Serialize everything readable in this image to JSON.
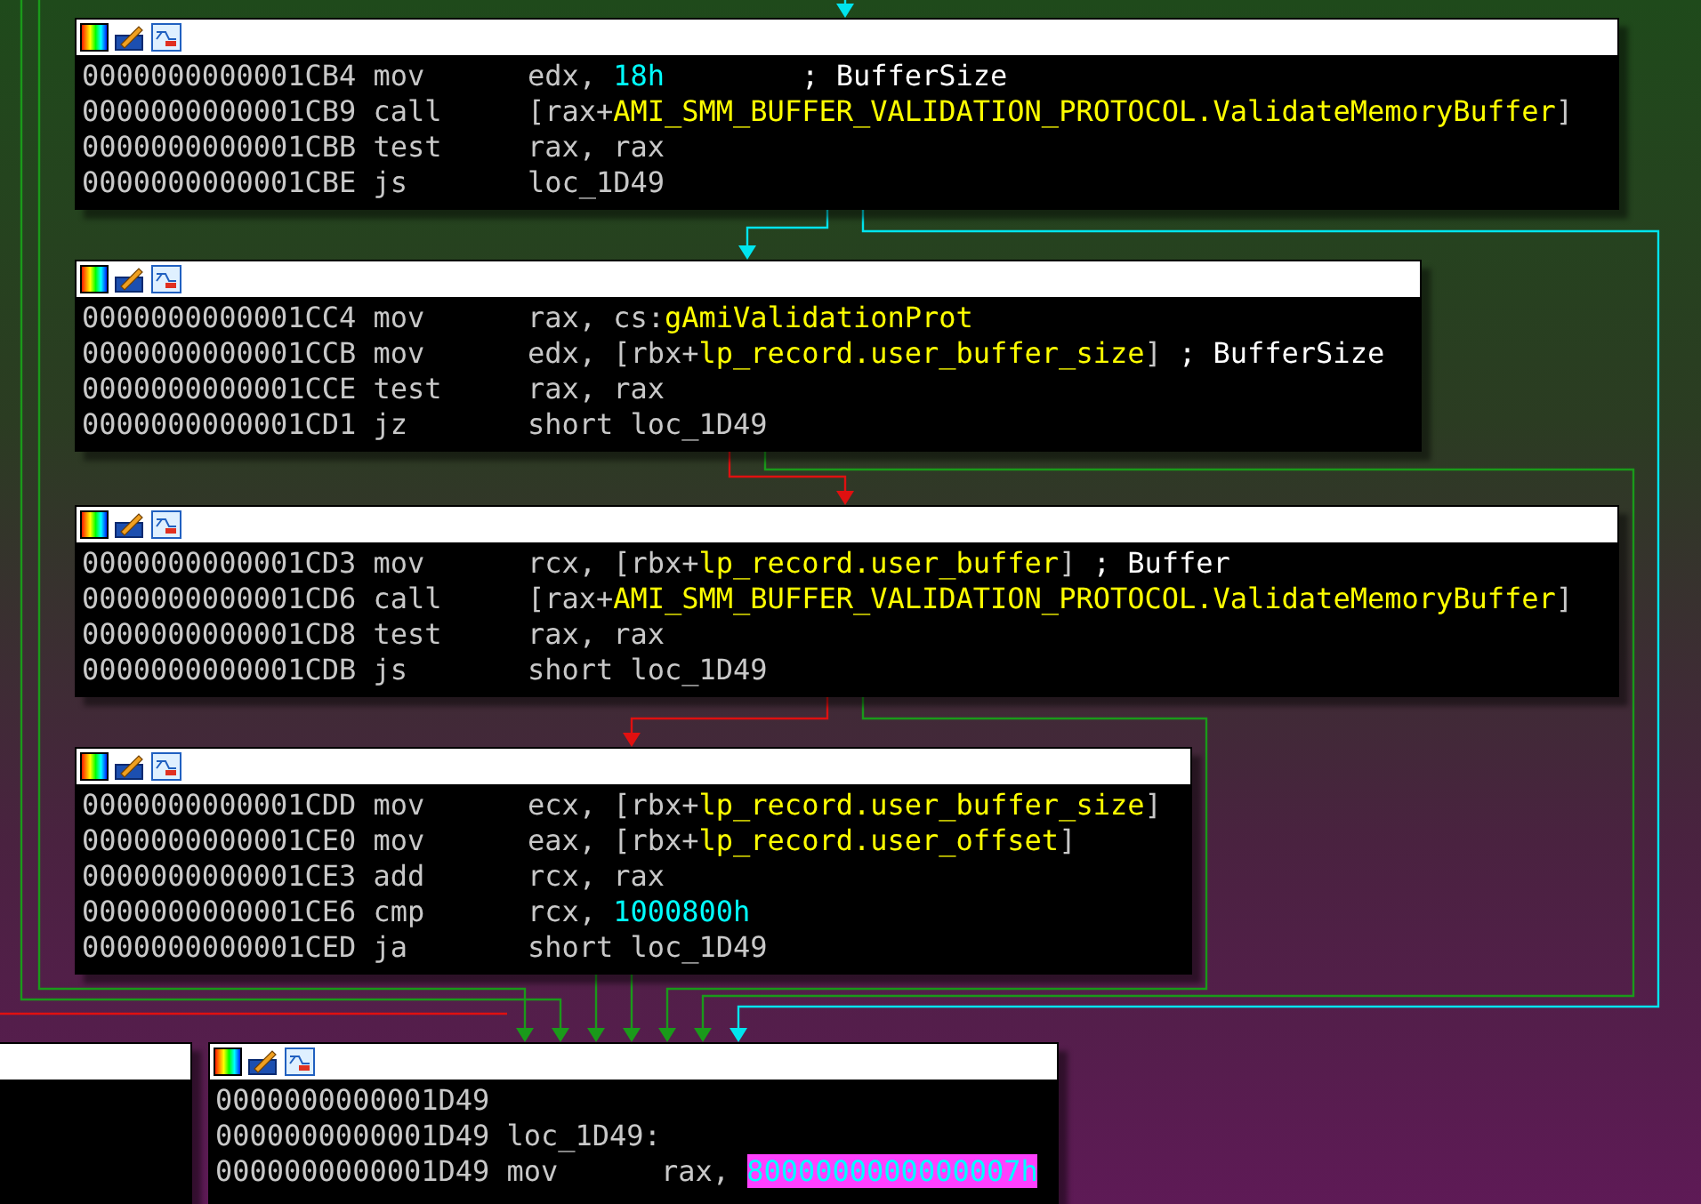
{
  "nodes": [
    {
      "kind": "block",
      "lines": [
        {
          "address": "0000000000001CB4",
          "mnemonic": "mov",
          "operands": [
            {
              "text": "edx, ",
              "kind": "plain"
            },
            {
              "text": "18h",
              "kind": "number"
            }
          ],
          "comment": "; BufferSize"
        },
        {
          "address": "0000000000001CB9",
          "mnemonic": "call",
          "operands": [
            {
              "text": "[rax+",
              "kind": "plain"
            },
            {
              "text": "AMI_SMM_BUFFER_VALIDATION_PROTOCOL.ValidateMemoryBuffer",
              "kind": "name"
            },
            {
              "text": "]",
              "kind": "plain"
            }
          ]
        },
        {
          "address": "0000000000001CBB",
          "mnemonic": "test",
          "operands": [
            {
              "text": "rax, rax",
              "kind": "plain"
            }
          ]
        },
        {
          "address": "0000000000001CBE",
          "mnemonic": "js",
          "operands": [
            {
              "text": "loc_1D49",
              "kind": "plain"
            }
          ]
        }
      ]
    },
    {
      "kind": "block",
      "lines": [
        {
          "address": "0000000000001CC4",
          "mnemonic": "mov",
          "operands": [
            {
              "text": "rax, cs:",
              "kind": "plain"
            },
            {
              "text": "gAmiValidationProt",
              "kind": "name"
            }
          ]
        },
        {
          "address": "0000000000001CCB",
          "mnemonic": "mov",
          "operands": [
            {
              "text": "edx, [rbx+",
              "kind": "plain"
            },
            {
              "text": "lp_record.user_buffer_size",
              "kind": "name"
            },
            {
              "text": "]",
              "kind": "plain"
            }
          ],
          "comment": "; BufferSize"
        },
        {
          "address": "0000000000001CCE",
          "mnemonic": "test",
          "operands": [
            {
              "text": "rax, rax",
              "kind": "plain"
            }
          ]
        },
        {
          "address": "0000000000001CD1",
          "mnemonic": "jz",
          "operands": [
            {
              "text": "short loc_1D49",
              "kind": "plain"
            }
          ]
        }
      ]
    },
    {
      "kind": "block",
      "lines": [
        {
          "address": "0000000000001CD3",
          "mnemonic": "mov",
          "operands": [
            {
              "text": "rcx, [rbx+",
              "kind": "plain"
            },
            {
              "text": "lp_record.user_buffer",
              "kind": "name"
            },
            {
              "text": "]",
              "kind": "plain"
            }
          ],
          "comment": "; Buffer"
        },
        {
          "address": "0000000000001CD6",
          "mnemonic": "call",
          "operands": [
            {
              "text": "[rax+",
              "kind": "plain"
            },
            {
              "text": "AMI_SMM_BUFFER_VALIDATION_PROTOCOL.ValidateMemoryBuffer",
              "kind": "name"
            },
            {
              "text": "]",
              "kind": "plain"
            }
          ]
        },
        {
          "address": "0000000000001CD8",
          "mnemonic": "test",
          "operands": [
            {
              "text": "rax, rax",
              "kind": "plain"
            }
          ]
        },
        {
          "address": "0000000000001CDB",
          "mnemonic": "js",
          "operands": [
            {
              "text": "short loc_1D49",
              "kind": "plain"
            }
          ]
        }
      ]
    },
    {
      "kind": "block",
      "lines": [
        {
          "address": "0000000000001CDD",
          "mnemonic": "mov",
          "operands": [
            {
              "text": "ecx, [rbx+",
              "kind": "plain"
            },
            {
              "text": "lp_record.user_buffer_size",
              "kind": "name"
            },
            {
              "text": "]",
              "kind": "plain"
            }
          ]
        },
        {
          "address": "0000000000001CE0",
          "mnemonic": "mov",
          "operands": [
            {
              "text": "eax, [rbx+",
              "kind": "plain"
            },
            {
              "text": "lp_record.user_offset",
              "kind": "name"
            },
            {
              "text": "]",
              "kind": "plain"
            }
          ]
        },
        {
          "address": "0000000000001CE3",
          "mnemonic": "add",
          "operands": [
            {
              "text": "rcx, rax",
              "kind": "plain"
            }
          ]
        },
        {
          "address": "0000000000001CE6",
          "mnemonic": "cmp",
          "operands": [
            {
              "text": "rcx, ",
              "kind": "plain"
            },
            {
              "text": "1000800h",
              "kind": "number"
            }
          ]
        },
        {
          "address": "0000000000001CED",
          "mnemonic": "ja",
          "operands": [
            {
              "text": "short loc_1D49",
              "kind": "plain"
            }
          ]
        }
      ]
    },
    {
      "kind": "partial"
    },
    {
      "kind": "block",
      "lines": [
        {
          "address": "0000000000001D49"
        },
        {
          "address": "0000000000001D49",
          "label": "loc_1D49:"
        },
        {
          "address": "0000000000001D49",
          "mnemonic": "mov",
          "operands": [
            {
              "text": "rax, ",
              "kind": "plain"
            },
            {
              "text": "8000000000000007h",
              "kind": "highlight"
            }
          ]
        }
      ]
    }
  ]
}
